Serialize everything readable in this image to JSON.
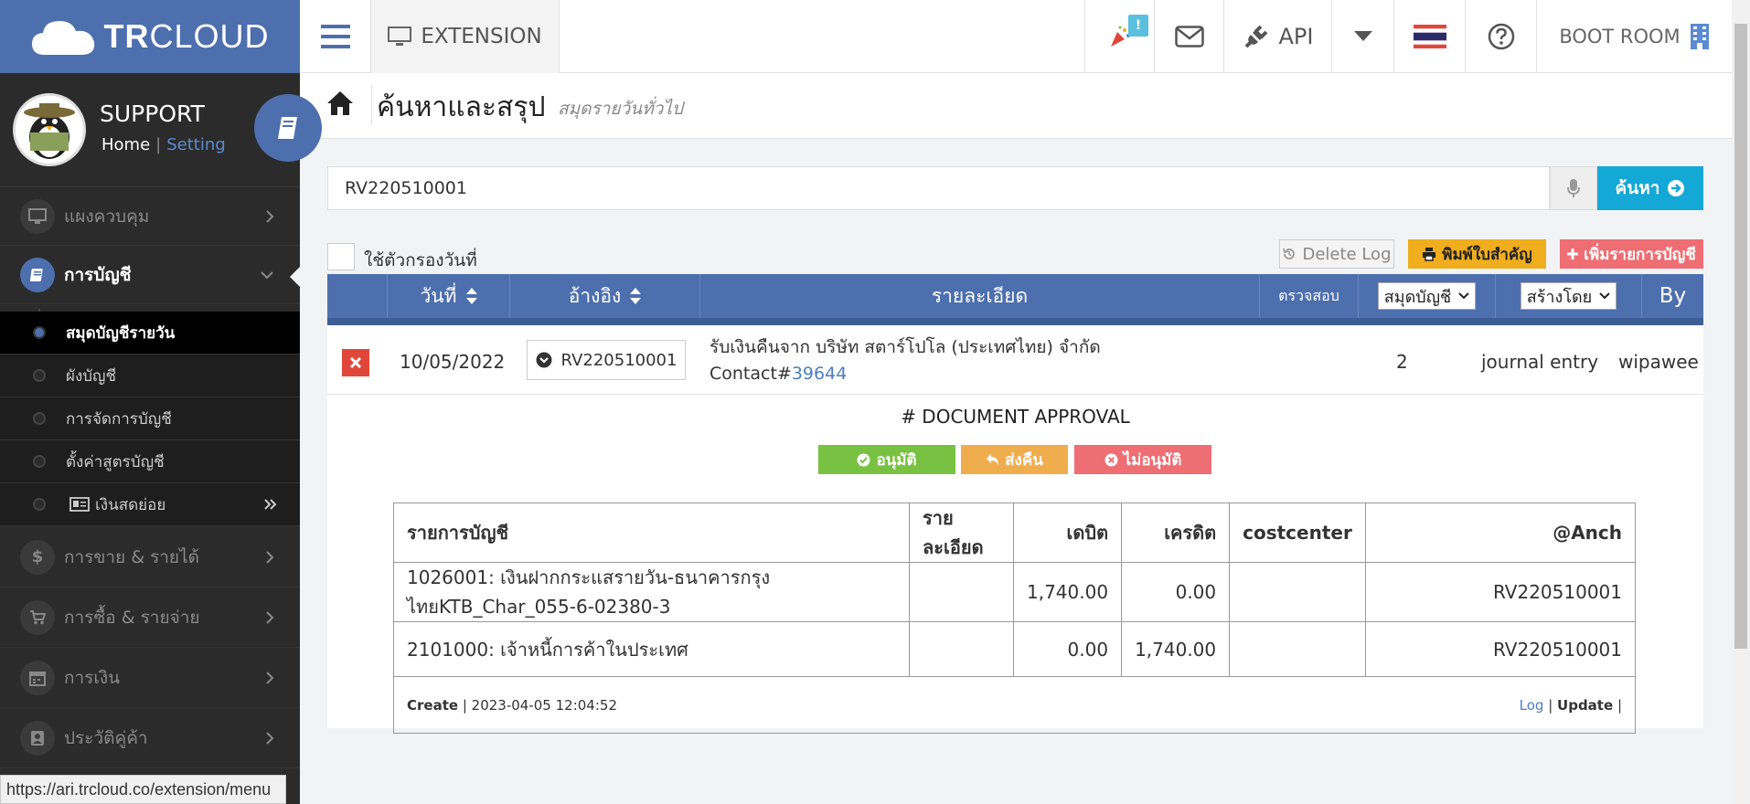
{
  "brand": {
    "prefix": "TR",
    "suffix": "CLOUD"
  },
  "topbar": {
    "extension_label": "EXTENSION",
    "notification_badge": "!",
    "api_label": "API",
    "room_label": "BOOT ROOM"
  },
  "profile": {
    "name": "SUPPORT",
    "home_link": "Home",
    "separator": "|",
    "setting_link": "Setting"
  },
  "sidebar": {
    "items": [
      {
        "label": "แผงควบคุม",
        "icon": "monitor-icon"
      },
      {
        "label": "การบัญชี",
        "icon": "book-icon"
      },
      {
        "label": "การขาย & รายได้",
        "icon": "dollar-icon"
      },
      {
        "label": "การซื้อ & รายจ่าย",
        "icon": "cart-icon"
      },
      {
        "label": "การเงิน",
        "icon": "calendar-icon"
      },
      {
        "label": "ประวัติคู่ค้า",
        "icon": "contact-icon"
      }
    ],
    "sub_items": [
      {
        "label": "สมุดบัญชีรายวัน"
      },
      {
        "label": "ผังบัญชี"
      },
      {
        "label": "การจัดการบัญชี"
      },
      {
        "label": "ตั้งค่าสูตรบัญชี"
      },
      {
        "label": "เงินสดย่อย"
      }
    ]
  },
  "status_url": "https://ari.trcloud.co/extension/menu",
  "page": {
    "title": "ค้นหาและสรุป",
    "subtitle": "สมุดรายวันทั่วไป"
  },
  "search": {
    "value": "RV220510001",
    "button_label": "ค้นหา"
  },
  "toolbar": {
    "date_filter_label": "ใช้ตัวกรองวันที่",
    "delete_log_label": "Delete Log",
    "print_label": "พิมพ์ใบสำคัญ",
    "add_entry_label": "เพิ่มรายการบัญชี"
  },
  "grid": {
    "headers": {
      "date": "วันที่",
      "reference": "อ้างอิง",
      "detail": "รายละเอียด",
      "check": "ตรวจสอบ",
      "book_select": "สมุดบัญชี",
      "created_select": "สร้างโดย",
      "by": "By"
    },
    "row": {
      "date": "10/05/2022",
      "reference": "RV220510001",
      "description": "รับเงินคืนจาก บริษัท สตาร์โปโล (ประเทศไทย) จำกัด",
      "contact_prefix": "Contact#",
      "contact_id": "39644",
      "check": "2",
      "book": "journal entry",
      "by": "wipawee"
    }
  },
  "approval": {
    "title": "# DOCUMENT APPROVAL",
    "approve_label": "อนุมัติ",
    "return_label": "ส่งคืน",
    "reject_label": "ไม่อนุมัติ"
  },
  "accounts_table": {
    "headers": [
      "รายการบัญชี",
      "รายละเอียด",
      "เดบิต",
      "เครดิต",
      "costcenter",
      "@Anch"
    ],
    "rows": [
      {
        "account": "1026001: เงินฝากกระแสรายวัน-ธนาคารกรุงไทยKTB_Char_055-6-02380-3",
        "detail": "",
        "debit": "1,740.00",
        "credit": "0.00",
        "costcenter": "",
        "anch": "RV220510001"
      },
      {
        "account": "2101000: เจ้าหนี้การค้าในประเทศ",
        "detail": "",
        "debit": "0.00",
        "credit": "1,740.00",
        "costcenter": "",
        "anch": "RV220510001"
      }
    ],
    "footer": {
      "create_label": "Create",
      "separator": "|",
      "created_at": "2023-04-05 12:04:52",
      "log_label": "Log",
      "update_label": "Update",
      "trailing_sep": "|"
    }
  },
  "colors": {
    "brand": "#4d6fae",
    "sidebar": "#2b2b2b",
    "search_button": "#14a8d6",
    "print_button": "#f0ad1e",
    "add_button": "#ee6e73",
    "approve": "#79c142",
    "return": "#f0ad4e",
    "reject": "#ee6e73"
  }
}
